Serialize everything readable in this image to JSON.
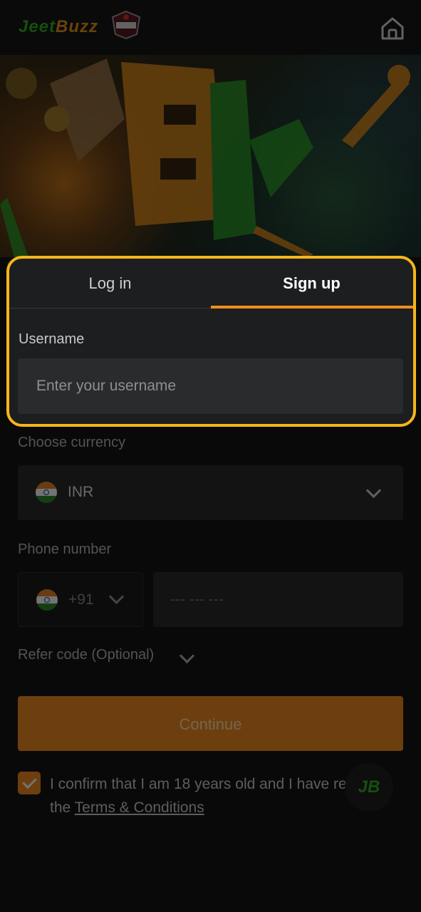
{
  "header": {
    "logo_part1": "Jeet",
    "logo_part2": "Buzz",
    "partner_badge_icon": "team-crest-icon",
    "home_icon": "home-icon"
  },
  "auth": {
    "tabs": [
      {
        "label": "Log in",
        "active": false
      },
      {
        "label": "Sign up",
        "active": true
      }
    ],
    "username": {
      "label": "Username",
      "placeholder": "Enter your username",
      "value": ""
    },
    "currency": {
      "label": "Choose currency",
      "selected": "INR"
    },
    "phone": {
      "label": "Phone number",
      "country_code": "+91",
      "placeholder": "--- --- ---"
    },
    "refer": {
      "label": "Refer code (Optional)"
    },
    "continue_label": "Continue",
    "confirm": {
      "text": "I confirm that I am 18 years old and I have read the",
      "link": "Terms & Conditions",
      "checked": true
    }
  },
  "chat": {
    "label": "JB"
  },
  "colors": {
    "accent": "#f28c20",
    "highlight_border": "#f6b61a",
    "background": "#141414",
    "field": "#2a2b2d"
  }
}
